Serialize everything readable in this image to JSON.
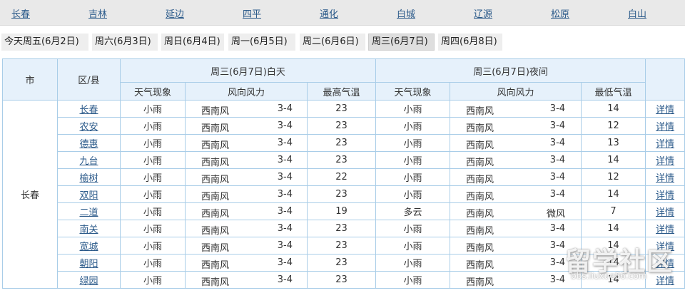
{
  "cities": [
    "长春",
    "吉林",
    "延边",
    "四平",
    "通化",
    "白城",
    "辽源",
    "松原",
    "白山"
  ],
  "day_tabs": [
    {
      "label": "今天周五(6月2日)",
      "active": false
    },
    {
      "label": "周六(6月3日)",
      "active": false
    },
    {
      "label": "周日(6月4日)",
      "active": false
    },
    {
      "label": "周一(6月5日)",
      "active": false
    },
    {
      "label": "周二(6月6日)",
      "active": false
    },
    {
      "label": "周三(6月7日)",
      "active": true
    },
    {
      "label": "周四(6月8日)",
      "active": false
    }
  ],
  "table": {
    "col_city": "市",
    "col_district": "区/县",
    "day_group": "周三(6月7日)白天",
    "night_group": "周三(6月7日)夜间",
    "day_cols": [
      "天气现象",
      "风向风力",
      "最高气温"
    ],
    "night_cols": [
      "天气现象",
      "风向风力",
      "最低气温"
    ],
    "city_name": "长春",
    "detail_label": "详情",
    "rows": [
      {
        "district": "长春",
        "day_weather": "小雨",
        "day_wind_dir": "西南风",
        "day_wind_power": "3-4",
        "high": "23",
        "night_weather": "小雨",
        "night_wind_dir": "西南风",
        "night_wind_power": "3-4",
        "low": "14"
      },
      {
        "district": "农安",
        "day_weather": "小雨",
        "day_wind_dir": "西南风",
        "day_wind_power": "3-4",
        "high": "23",
        "night_weather": "小雨",
        "night_wind_dir": "西南风",
        "night_wind_power": "3-4",
        "low": "12"
      },
      {
        "district": "德惠",
        "day_weather": "小雨",
        "day_wind_dir": "西南风",
        "day_wind_power": "3-4",
        "high": "23",
        "night_weather": "小雨",
        "night_wind_dir": "西南风",
        "night_wind_power": "3-4",
        "low": "13"
      },
      {
        "district": "九台",
        "day_weather": "小雨",
        "day_wind_dir": "西南风",
        "day_wind_power": "3-4",
        "high": "23",
        "night_weather": "小雨",
        "night_wind_dir": "西南风",
        "night_wind_power": "3-4",
        "low": "14"
      },
      {
        "district": "榆树",
        "day_weather": "小雨",
        "day_wind_dir": "西南风",
        "day_wind_power": "3-4",
        "high": "22",
        "night_weather": "小雨",
        "night_wind_dir": "西南风",
        "night_wind_power": "3-4",
        "low": "12"
      },
      {
        "district": "双阳",
        "day_weather": "小雨",
        "day_wind_dir": "西南风",
        "day_wind_power": "3-4",
        "high": "23",
        "night_weather": "小雨",
        "night_wind_dir": "西南风",
        "night_wind_power": "3-4",
        "low": "14"
      },
      {
        "district": "二道",
        "day_weather": "小雨",
        "day_wind_dir": "西南风",
        "day_wind_power": "3-4",
        "high": "19",
        "night_weather": "多云",
        "night_wind_dir": "西南风",
        "night_wind_power": "微风",
        "low": "7"
      },
      {
        "district": "南关",
        "day_weather": "小雨",
        "day_wind_dir": "西南风",
        "day_wind_power": "3-4",
        "high": "23",
        "night_weather": "小雨",
        "night_wind_dir": "西南风",
        "night_wind_power": "3-4",
        "low": "14"
      },
      {
        "district": "宽城",
        "day_weather": "小雨",
        "day_wind_dir": "西南风",
        "day_wind_power": "3-4",
        "high": "23",
        "night_weather": "小雨",
        "night_wind_dir": "西南风",
        "night_wind_power": "3-4",
        "low": "14"
      },
      {
        "district": "朝阳",
        "day_weather": "小雨",
        "day_wind_dir": "西南风",
        "day_wind_power": "3-4",
        "high": "23",
        "night_weather": "小雨",
        "night_wind_dir": "西南风",
        "night_wind_power": "3-4",
        "low": "14"
      },
      {
        "district": "绿园",
        "day_weather": "小雨",
        "day_wind_dir": "西南风",
        "day_wind_power": "3-4",
        "high": "23",
        "night_weather": "小雨",
        "night_wind_dir": "西南风",
        "night_wind_power": "3-4",
        "low": "14"
      }
    ]
  },
  "watermark": {
    "main": "留学社区",
    "url": "bbs.liuxue86.com"
  }
}
